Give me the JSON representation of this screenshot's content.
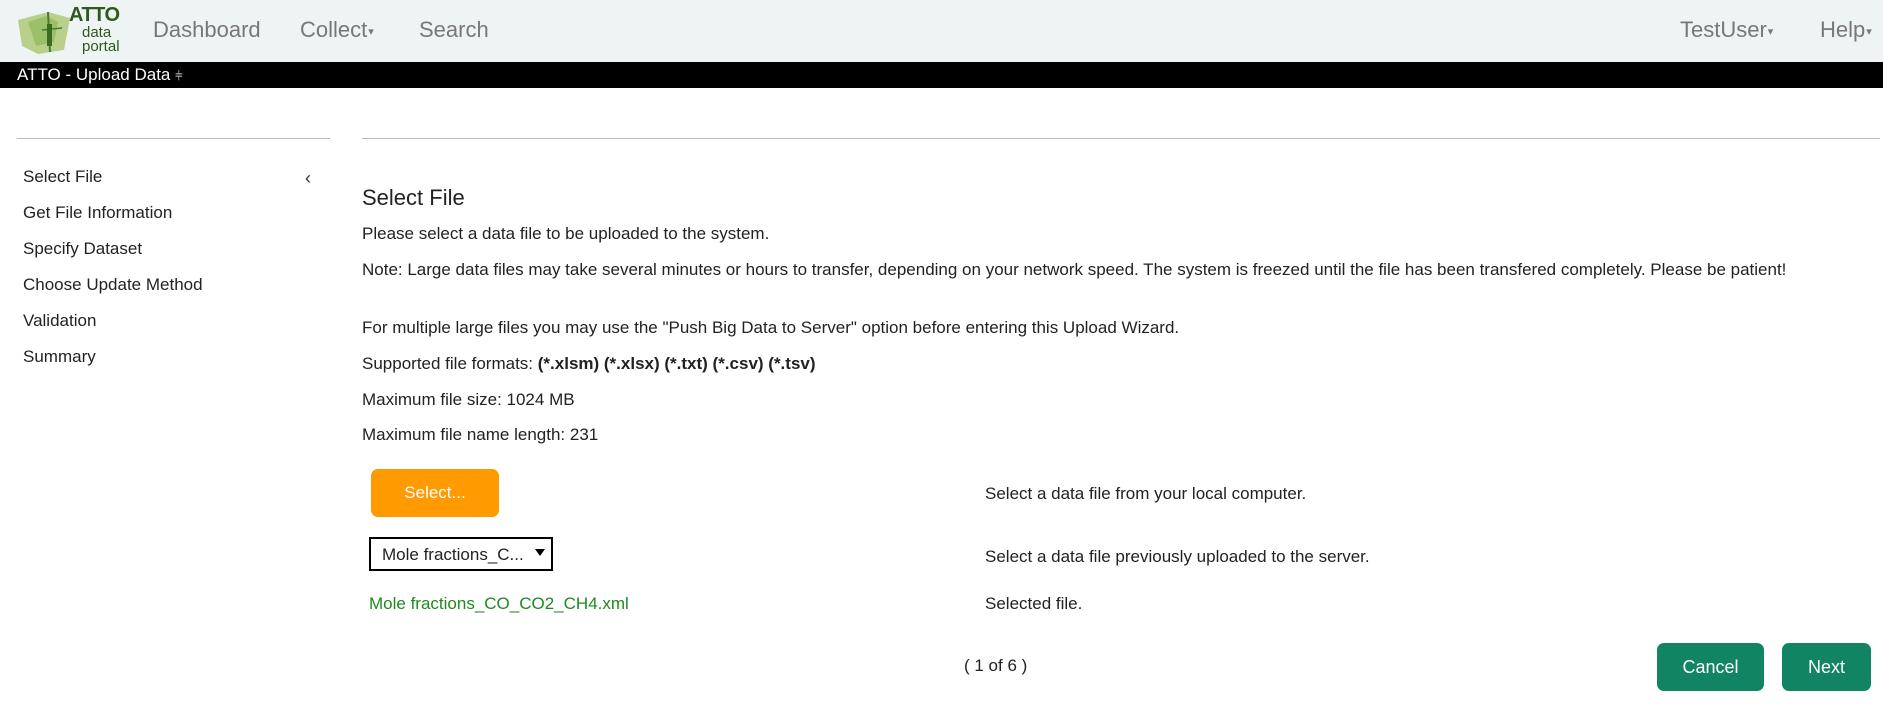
{
  "nav": {
    "logo": {
      "title": "ATTO",
      "sub1": "data",
      "sub2": "portal"
    },
    "items": [
      {
        "label": "Dashboard"
      },
      {
        "label": "Collect"
      },
      {
        "label": "Search"
      }
    ],
    "user": "TestUser",
    "help": "Help"
  },
  "strip": {
    "label": "ATTO - Upload Data"
  },
  "sidebar": {
    "steps": [
      {
        "label": "Select File"
      },
      {
        "label": "Get File Information"
      },
      {
        "label": "Specify Dataset"
      },
      {
        "label": "Choose Update Method"
      },
      {
        "label": "Validation"
      },
      {
        "label": "Summary"
      }
    ],
    "collapse_icon": "chevron-left-icon"
  },
  "main": {
    "title": "Select File",
    "intro": "Please select a data file to be uploaded to the system.",
    "note": "Note: Large data files may take several minutes or hours to transfer, depending on your network speed. The system is freezed until the file has been transfered completely. Please be patient!",
    "multi": "For multiple large files you may use the \"Push Big Data to Server\" option before entering this Upload Wizard.",
    "formats_label": "Supported file formats:",
    "formats_value": "(*.xlsm) (*.xlsx) (*.txt) (*.csv) (*.tsv)",
    "max_size": "Maximum file size: 1024 MB",
    "max_name": "Maximum file name length: 231",
    "select_button": "Select...",
    "select_desc": "Select a data file from your local computer.",
    "server_file_value": "Mole fractions_CO_CO2_CH4.xml",
    "server_file_display": "Mole fractions_C...",
    "server_desc": "Select a data file previously uploaded to the server.",
    "selected_file": "Mole fractions_CO_CO2_CH4.xml",
    "selected_desc": "Selected file."
  },
  "footer": {
    "pager": "( 1 of 6 )",
    "cancel": "Cancel",
    "next": "Next"
  },
  "colors": {
    "accent_orange": "#ff9b00",
    "button_green": "#118463",
    "selected_file_green": "#1e8a1e",
    "nav_bg": "#eef4f3"
  }
}
